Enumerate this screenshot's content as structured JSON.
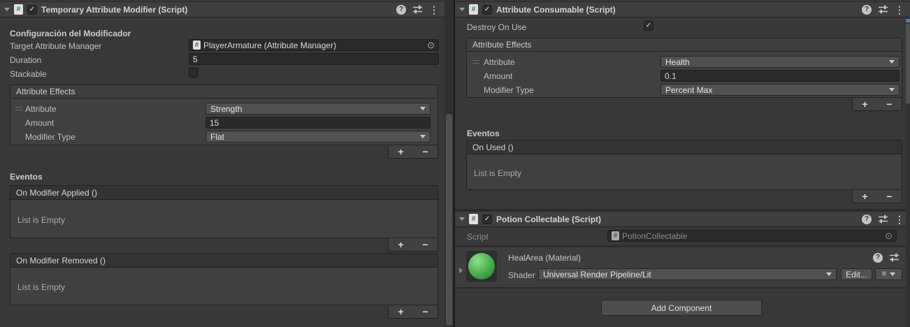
{
  "icons": {
    "hash": "#",
    "check": "✓",
    "help": "?",
    "kebab": "⋮",
    "picker": "⊙",
    "plus": "+",
    "minus": "−",
    "list": "≡"
  },
  "colors": {
    "panel_bg": "#383838",
    "header_bg": "#3F3F3F",
    "field_bg": "#2A2A2A",
    "dropdown_bg": "#515151",
    "script_icon_green": "#2E8B2E",
    "sphere_green": "#45AC49"
  },
  "left": {
    "title": "Temporary Attribute Modifier (Script)",
    "section_title": "Configuración del Modificador",
    "target": {
      "label": "Target Attribute Manager",
      "value": "PlayerArmature (Attribute Manager)"
    },
    "duration": {
      "label": "Duration",
      "value": "5"
    },
    "stackable": {
      "label": "Stackable",
      "checked": false
    },
    "effects": {
      "title": "Attribute Effects",
      "attribute": {
        "label": "Attribute",
        "value": "Strength"
      },
      "amount": {
        "label": "Amount",
        "value": "15"
      },
      "modifier_type": {
        "label": "Modifier Type",
        "value": "Flat"
      }
    },
    "events_title": "Eventos",
    "on_applied": {
      "header": "On Modifier Applied ()",
      "empty": "List is Empty"
    },
    "on_removed": {
      "header": "On Modifier Removed ()",
      "empty": "List is Empty"
    }
  },
  "right": {
    "consumable": {
      "title": "Attribute Consumable (Script)",
      "destroy_on_use": {
        "label": "Destroy On Use",
        "checked": true
      },
      "effects": {
        "title": "Attribute Effects",
        "attribute": {
          "label": "Attribute",
          "value": "Health"
        },
        "amount": {
          "label": "Amount",
          "value": "0.1"
        },
        "modifier_type": {
          "label": "Modifier Type",
          "value": "Percent Max"
        }
      },
      "events_title": "Eventos",
      "on_used": {
        "header": "On Used ()",
        "empty": "List is Empty"
      }
    },
    "potion": {
      "title": "Potion Collectable (Script)",
      "script": {
        "label": "Script",
        "value": "PotionCollectable"
      }
    },
    "material": {
      "title": "HealArea (Material)",
      "shader": {
        "label": "Shader",
        "value": "Universal Render Pipeline/Lit"
      },
      "edit_button": "Edit..."
    },
    "add_component_button": "Add Component"
  }
}
